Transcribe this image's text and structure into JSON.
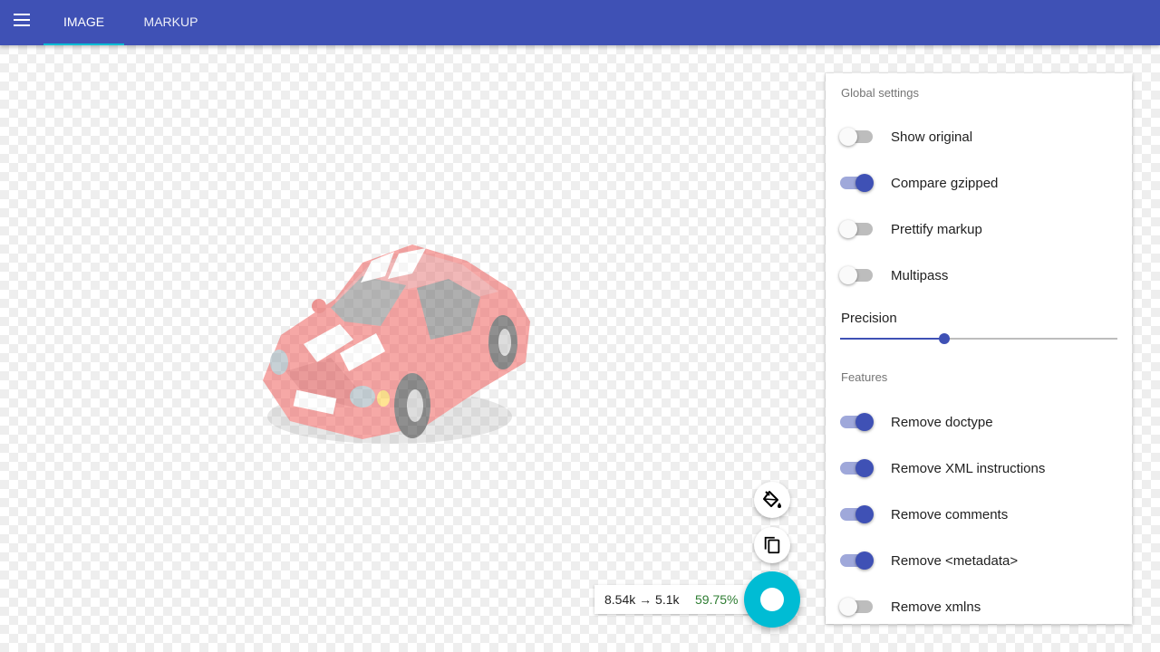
{
  "appbar": {
    "menu_icon": "menu-icon",
    "tabs": [
      {
        "label": "IMAGE",
        "active": true
      },
      {
        "label": "MARKUP",
        "active": false
      }
    ],
    "color": "#3f51b5",
    "indicator_color": "#00bcd4"
  },
  "preview": {
    "subject": "red car with white stripes",
    "opacity": 0.5
  },
  "settings": {
    "global_title": "Global settings",
    "global": [
      {
        "label": "Show original",
        "on": false
      },
      {
        "label": "Compare gzipped",
        "on": true
      },
      {
        "label": "Prettify markup",
        "on": false
      },
      {
        "label": "Multipass",
        "on": false
      }
    ],
    "precision_label": "Precision",
    "precision_fraction": 0.375,
    "features_title": "Features",
    "features": [
      {
        "label": "Remove doctype",
        "on": true
      },
      {
        "label": "Remove XML instructions",
        "on": true
      },
      {
        "label": "Remove comments",
        "on": true
      },
      {
        "label": "Remove <metadata>",
        "on": true
      },
      {
        "label": "Remove xmlns",
        "on": false
      }
    ]
  },
  "stats": {
    "sizes": "8.54k → 5.1k",
    "percent": "59.75%",
    "percent_color": "#2e7d32"
  },
  "fabs": {
    "background_icon": "paint-bucket-icon",
    "copy_icon": "copy-icon",
    "main_icon": "download-icon",
    "main_color": "#00bcd4"
  }
}
